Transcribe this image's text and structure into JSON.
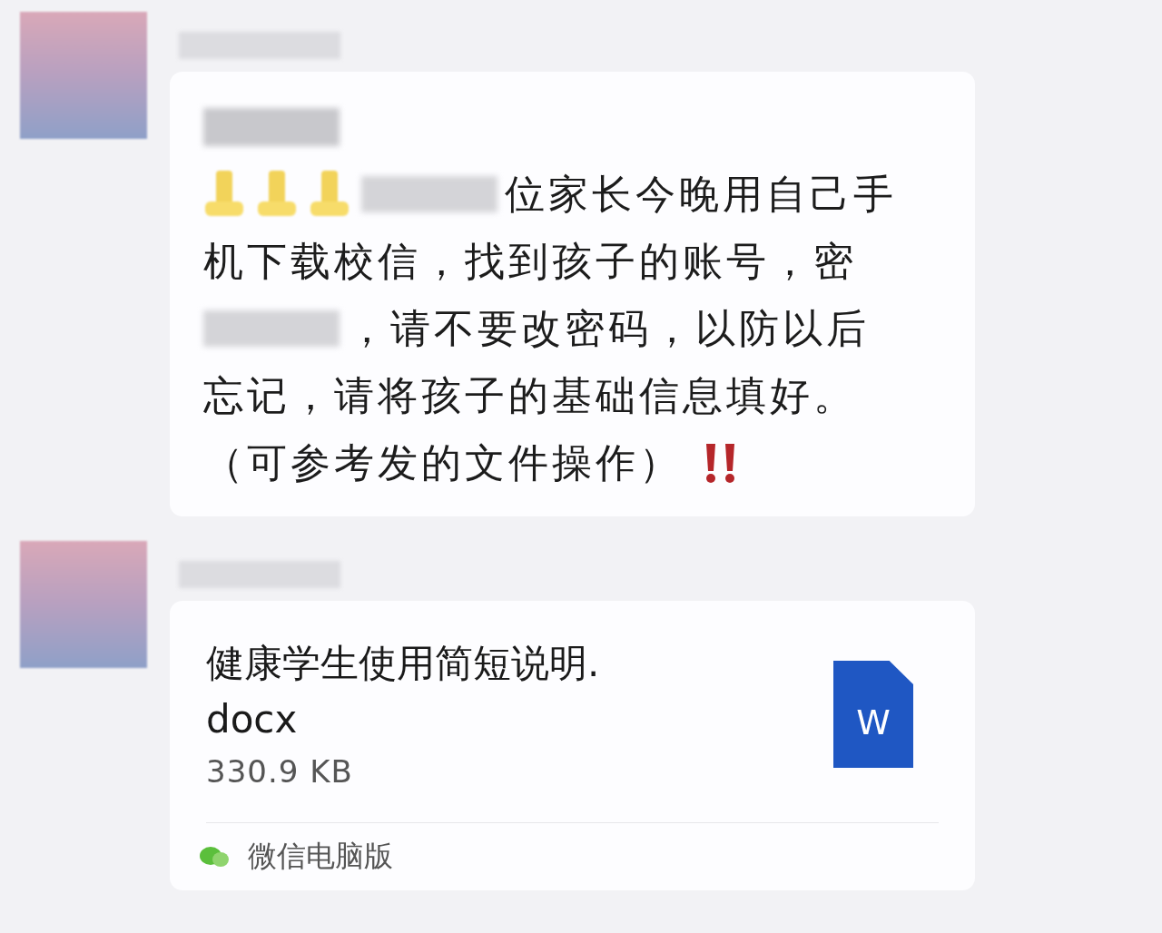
{
  "messages": [
    {
      "kind": "announcement",
      "lines": [
        [
          {
            "kind": "heading_blur"
          }
        ],
        [
          {
            "kind": "emoji"
          },
          {
            "kind": "emoji"
          },
          {
            "kind": "emoji"
          },
          {
            "kind": "blur"
          },
          {
            "kind": "text",
            "text": "位家长今晚用自己手"
          }
        ],
        [
          {
            "kind": "text",
            "text": "机下载校信，找到孩子的账号，密"
          }
        ],
        [
          {
            "kind": "blur"
          },
          {
            "kind": "text",
            "text": "，请不要改密码，以防以后"
          }
        ],
        [
          {
            "kind": "text",
            "text": "忘记，请将孩子的基础信息填好。"
          }
        ],
        [
          {
            "kind": "text",
            "text": "（可参考发的文件操作）"
          },
          {
            "kind": "alert"
          }
        ]
      ]
    },
    {
      "kind": "file",
      "file_name": "健康学生使用简短说明.docx",
      "size": "330.9 KB",
      "icon_letter": "W",
      "source": "微信电脑版"
    }
  ]
}
